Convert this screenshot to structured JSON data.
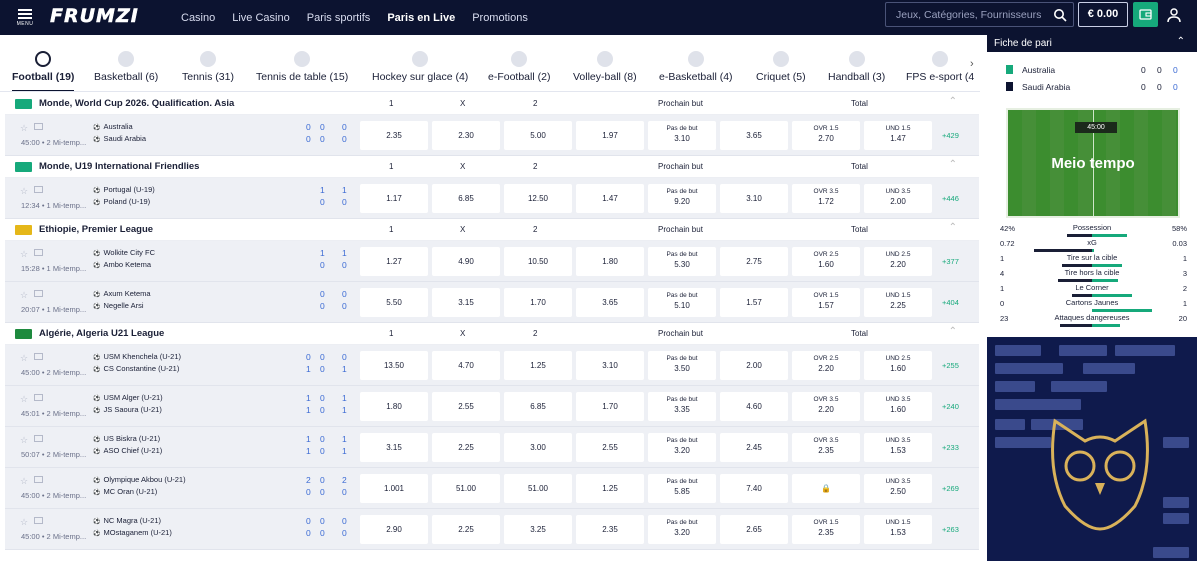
{
  "header": {
    "menu_label": "MENU",
    "logo": "FRUMZI",
    "nav": [
      "Casino",
      "Live Casino",
      "Paris sportifs",
      "Paris en Live",
      "Promotions"
    ],
    "active_nav": "Paris en Live",
    "search_placeholder": "Jeux, Catégories, Fournisseurs",
    "balance": "€ 0.00"
  },
  "sport_tabs": [
    {
      "label": "Football (19)",
      "active": true
    },
    {
      "label": "Basketball (6)"
    },
    {
      "label": "Tennis (31)"
    },
    {
      "label": "Tennis de table (15)"
    },
    {
      "label": "Hockey sur glace (4)"
    },
    {
      "label": "e-Football (2)"
    },
    {
      "label": "Volley-ball (8)"
    },
    {
      "label": "e-Basketball (4)"
    },
    {
      "label": "Criquet (5)"
    },
    {
      "label": "Handball (3)"
    },
    {
      "label": "FPS e-sport (4"
    }
  ],
  "col_headers": {
    "c1": "1",
    "cx": "X",
    "c2": "2",
    "next_goal": "Prochain but",
    "total": "Total"
  },
  "leagues": [
    {
      "name": "Monde, World Cup 2026. Qualification. Asia",
      "flag_color": "#16a97b",
      "matches": [
        {
          "time": "45:00 • 2 Mi-temp...",
          "team1": "Australia",
          "team2": "Saudi Arabia",
          "s1": [
            "0",
            "0",
            "0"
          ],
          "s2": [
            "0",
            "0",
            "0"
          ],
          "odds": [
            "2.35",
            "2.30",
            "5.00",
            "1.97"
          ],
          "nb_label": "Pas de but",
          "nb_val": "3.10",
          "nb2": "3.65",
          "ovr_label": "OVR 1.5",
          "ovr": "2.70",
          "und_label": "UND 1.5",
          "und": "1.47",
          "more": "+429"
        }
      ]
    },
    {
      "name": "Monde, U19 International Friendlies",
      "flag_color": "#16a97b",
      "matches": [
        {
          "time": "12:34 • 1 Mi-temp...",
          "team1": "Portugal (U-19)",
          "team2": "Poland (U-19)",
          "s1": [
            "",
            "1",
            "1"
          ],
          "s2": [
            "",
            "0",
            "0"
          ],
          "odds": [
            "1.17",
            "6.85",
            "12.50",
            "1.47"
          ],
          "nb_label": "Pas de but",
          "nb_val": "9.20",
          "nb2": "3.10",
          "ovr_label": "OVR 3.5",
          "ovr": "1.72",
          "und_label": "UND 3.5",
          "und": "2.00",
          "more": "+446"
        }
      ]
    },
    {
      "name": "Ethiopie, Premier League",
      "flag_color": "#e5b719",
      "matches": [
        {
          "time": "15:28 • 1 Mi-temp...",
          "team1": "Wolkite City FC",
          "team2": "Ambo Ketema",
          "s1": [
            "",
            "1",
            "1"
          ],
          "s2": [
            "",
            "0",
            "0"
          ],
          "odds": [
            "1.27",
            "4.90",
            "10.50",
            "1.80"
          ],
          "nb_label": "Pas de but",
          "nb_val": "5.30",
          "nb2": "2.75",
          "ovr_label": "OVR 2.5",
          "ovr": "1.60",
          "und_label": "UND 2.5",
          "und": "2.20",
          "more": "+377"
        },
        {
          "time": "20:07 • 1 Mi-temp...",
          "team1": "Axum Ketema",
          "team2": "Negelle Arsi",
          "s1": [
            "",
            "0",
            "0"
          ],
          "s2": [
            "",
            "0",
            "0"
          ],
          "odds": [
            "5.50",
            "3.15",
            "1.70",
            "3.65"
          ],
          "nb_label": "Pas de but",
          "nb_val": "5.10",
          "nb2": "1.57",
          "ovr_label": "OVR 1.5",
          "ovr": "1.57",
          "und_label": "UND 1.5",
          "und": "2.25",
          "more": "+404"
        }
      ]
    },
    {
      "name": "Algérie, Algeria U21 League",
      "flag_color": "#1e8a3e",
      "matches": [
        {
          "time": "45:00 • 2 Mi-temp...",
          "team1": "USM Khenchela (U-21)",
          "team2": "CS Constantine (U-21)",
          "s1": [
            "0",
            "0",
            "0"
          ],
          "s2": [
            "1",
            "0",
            "1"
          ],
          "odds": [
            "13.50",
            "4.70",
            "1.25",
            "3.10"
          ],
          "nb_label": "Pas de but",
          "nb_val": "3.50",
          "nb2": "2.00",
          "ovr_label": "OVR 2.5",
          "ovr": "2.20",
          "und_label": "UND 2.5",
          "und": "1.60",
          "more": "+255"
        },
        {
          "time": "45:01 • 2 Mi-temp...",
          "team1": "USM Alger (U-21)",
          "team2": "JS Saoura (U-21)",
          "s1": [
            "1",
            "0",
            "1"
          ],
          "s2": [
            "1",
            "0",
            "1"
          ],
          "odds": [
            "1.80",
            "2.55",
            "6.85",
            "1.70"
          ],
          "nb_label": "Pas de but",
          "nb_val": "3.35",
          "nb2": "4.60",
          "ovr_label": "OVR 3.5",
          "ovr": "2.20",
          "und_label": "UND 3.5",
          "und": "1.60",
          "more": "+240"
        },
        {
          "time": "50:07 • 2 Mi-temp...",
          "team1": "US Biskra (U-21)",
          "team2": "ASO Chief (U-21)",
          "s1": [
            "1",
            "0",
            "1"
          ],
          "s2": [
            "1",
            "0",
            "1"
          ],
          "odds": [
            "3.15",
            "2.25",
            "3.00",
            "2.55"
          ],
          "nb_label": "Pas de but",
          "nb_val": "3.20",
          "nb2": "2.45",
          "ovr_label": "OVR 3.5",
          "ovr": "2.35",
          "und_label": "UND 3.5",
          "und": "1.53",
          "more": "+233"
        },
        {
          "time": "45:00 • 2 Mi-temp...",
          "team1": "Olympique Akbou (U-21)",
          "team2": "MC Oran (U-21)",
          "s1": [
            "2",
            "0",
            "2"
          ],
          "s2": [
            "0",
            "0",
            "0"
          ],
          "odds": [
            "1.001",
            "51.00",
            "51.00",
            "1.25"
          ],
          "nb_label": "Pas de but",
          "nb_val": "5.85",
          "nb2": "7.40",
          "ovr_label": "",
          "ovr": "",
          "und_label": "UND 3.5",
          "und": "2.50",
          "more": "+269"
        },
        {
          "time": "45:00 • 2 Mi-temp...",
          "team1": "NC Magra (U-21)",
          "team2": "MOstaganem (U-21)",
          "s1": [
            "0",
            "0",
            "0"
          ],
          "s2": [
            "0",
            "0",
            "0"
          ],
          "odds": [
            "2.90",
            "2.25",
            "3.25",
            "2.35"
          ],
          "nb_label": "Pas de but",
          "nb_val": "3.20",
          "nb2": "2.65",
          "ovr_label": "OVR 1.5",
          "ovr": "2.35",
          "und_label": "UND 1.5",
          "und": "1.53",
          "more": "+263"
        }
      ]
    }
  ],
  "sidebar": {
    "title": "Fiche de pari",
    "team1": "Australia",
    "team2": "Saudi Arabia",
    "t1_scores": [
      "0",
      "0",
      "0"
    ],
    "t2_scores": [
      "0",
      "0",
      "0"
    ],
    "clock": "45:00",
    "status": "Meio tempo",
    "stats": [
      {
        "name": "Possession",
        "a": "42%",
        "b": "58%",
        "share": 0.42
      },
      {
        "name": "xG",
        "a": "0.72",
        "b": "0.03",
        "share": 0.96
      },
      {
        "name": "Tire sur la cible",
        "a": "1",
        "b": "1",
        "share": 0.5
      },
      {
        "name": "Tire hors la cible",
        "a": "4",
        "b": "3",
        "share": 0.57
      },
      {
        "name": "Le Corner",
        "a": "1",
        "b": "2",
        "share": 0.33
      },
      {
        "name": "Cartons Jaunes",
        "a": "0",
        "b": "1",
        "share": 0.0
      },
      {
        "name": "Attaques dangereuses",
        "a": "23",
        "b": "20",
        "share": 0.53
      }
    ]
  }
}
